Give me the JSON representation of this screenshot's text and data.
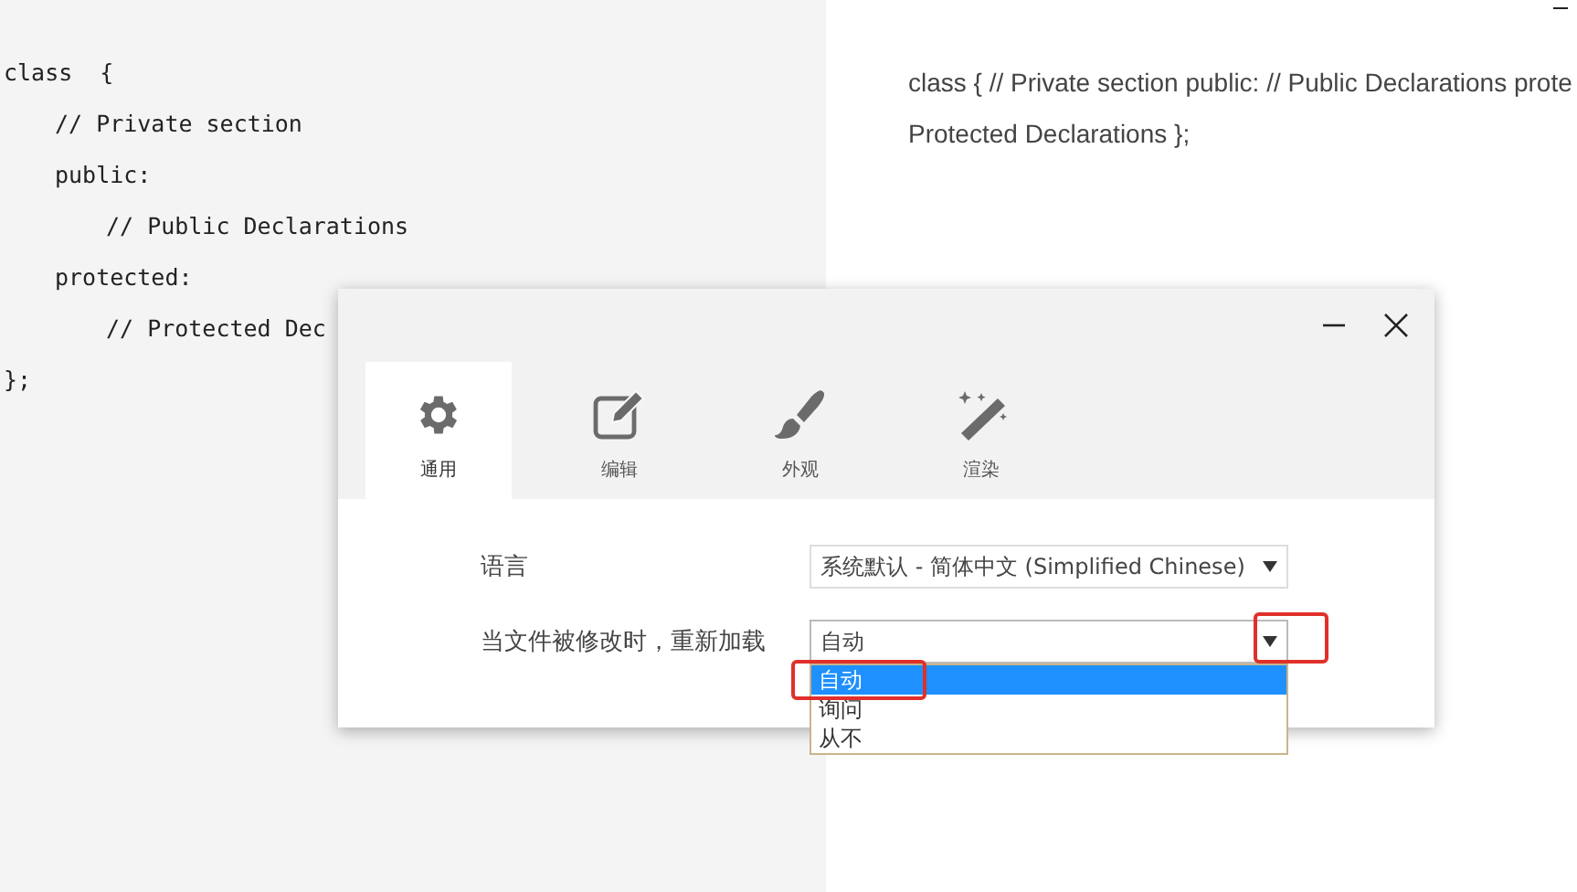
{
  "code_editor": {
    "lines": [
      {
        "text": "class  {",
        "children": [
          {
            "text": "// Private section"
          },
          {
            "text": "public:",
            "children": [
              {
                "text": "// Public Declarations"
              }
            ]
          },
          {
            "text": "protected:",
            "children": [
              {
                "text": "// Protected Dec"
              }
            ]
          }
        ]
      },
      {
        "text": "};"
      }
    ]
  },
  "preview": {
    "lines": [
      "class { // Private section public: // Public Declarations prote",
      "Protected Declarations };"
    ]
  },
  "settings_dialog": {
    "tabs": [
      {
        "label": "通用",
        "selected": true
      },
      {
        "label": "编辑",
        "selected": false
      },
      {
        "label": "外观",
        "selected": false
      },
      {
        "label": "渲染",
        "selected": false
      }
    ],
    "fields": [
      {
        "label": "语言",
        "value": "系统默认 - 简体中文 (Simplified Chinese)",
        "expanded": false
      },
      {
        "label": "当文件被修改时，重新加载",
        "value": "自动",
        "expanded": true,
        "options": [
          {
            "label": "自动",
            "selected": true
          },
          {
            "label": "询问",
            "selected": false
          },
          {
            "label": "从不",
            "selected": false
          }
        ]
      }
    ]
  }
}
